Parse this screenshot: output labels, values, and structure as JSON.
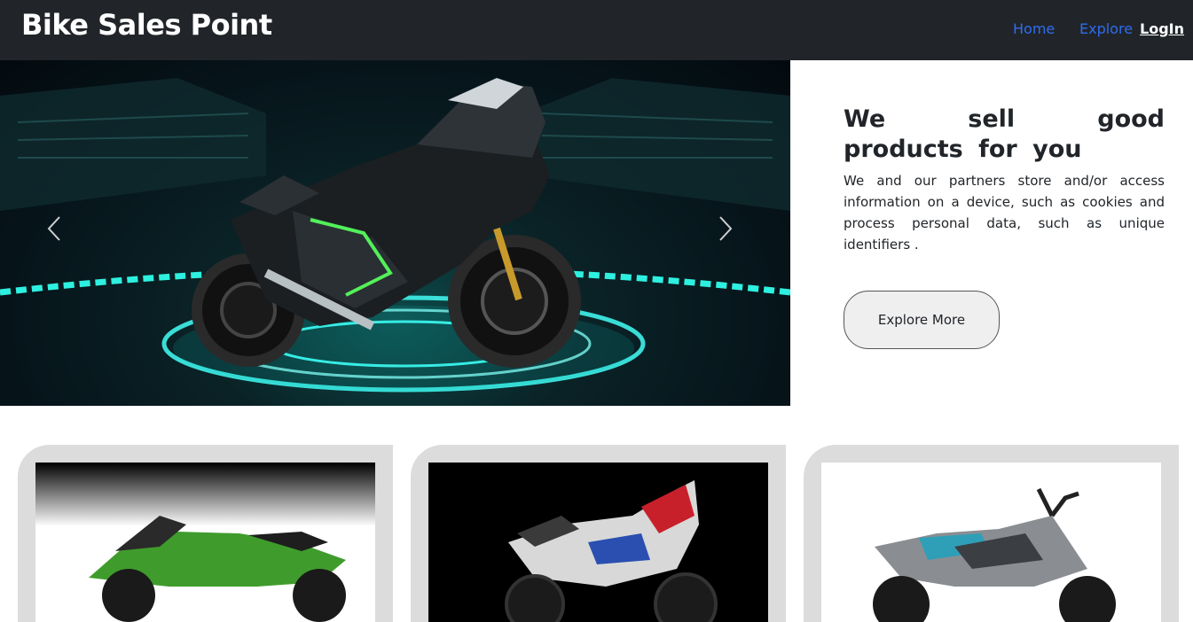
{
  "navbar": {
    "brand": "Bike Sales Point",
    "links": {
      "home": "Home",
      "explore": "Explore",
      "login": "LogIn"
    }
  },
  "hero": {
    "title": "We sell good products for you",
    "description": "We and our partners store and/or access information on a device, such as cookies and process personal data, such as unique identifiers .",
    "cta_label": "Explore More"
  },
  "colors": {
    "navbar_bg": "#212529",
    "link_blue": "#2f6cf0",
    "card_bg": "#dcdcdc"
  }
}
